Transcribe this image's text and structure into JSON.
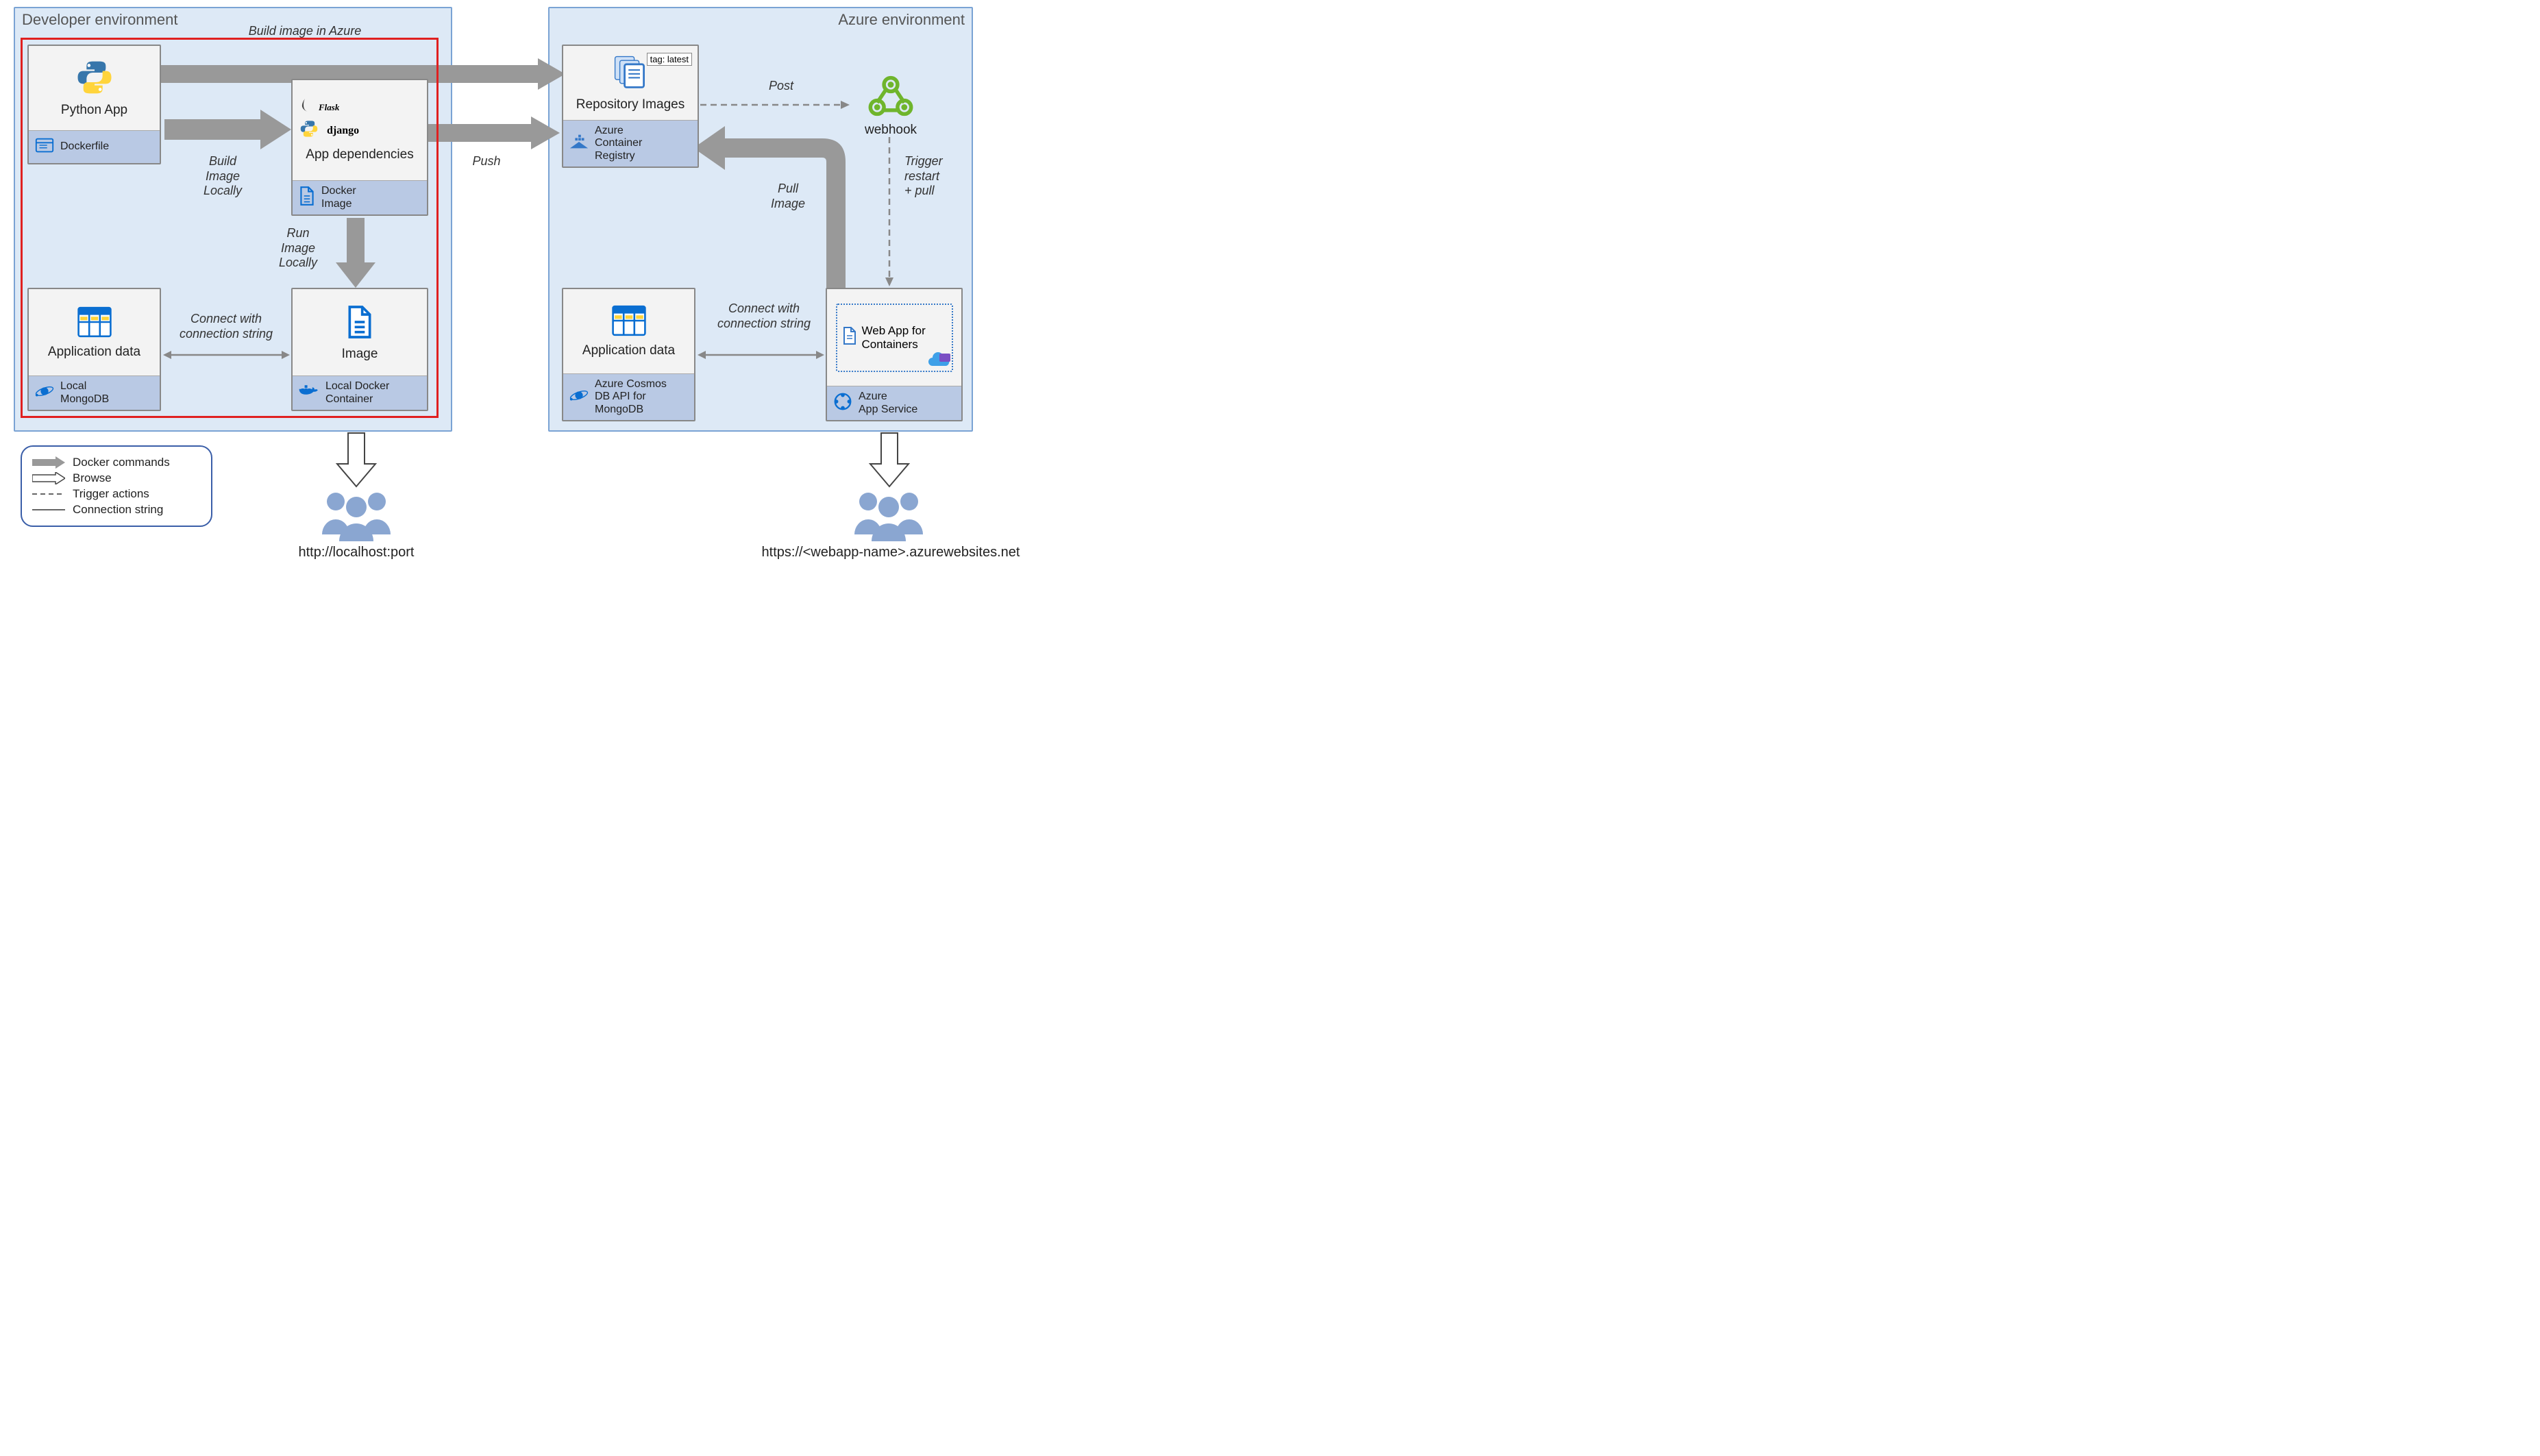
{
  "environments": {
    "dev": {
      "title": "Developer environment"
    },
    "azure": {
      "title": "Azure environment"
    }
  },
  "cards": {
    "pythonApp": {
      "title": "Python App",
      "footer": "Dockerfile"
    },
    "appDeps": {
      "title": "App dependencies",
      "footer": "Docker\nImage",
      "tech": {
        "flask": "Flask",
        "django": "django"
      }
    },
    "appDataLocal": {
      "title": "Application data",
      "footer": "Local\nMongoDB"
    },
    "image": {
      "title": "Image",
      "footer": "Local Docker\nContainer"
    },
    "repoImages": {
      "title": "Repository Images",
      "footer": "Azure\nContainer\nRegistry",
      "tag": "tag: latest"
    },
    "webhook": {
      "title": "webhook"
    },
    "appDataAzure": {
      "title": "Application data",
      "footer": "Azure Cosmos\nDB API for\nMongoDB"
    },
    "webApp": {
      "inner": "Web App for\nContainers",
      "footer": "Azure\nApp Service"
    }
  },
  "labels": {
    "buildAzure": "Build image in Azure",
    "buildLocal": "Build\nImage\nLocally",
    "runLocal": "Run\nImage\nLocally",
    "connectLocal": "Connect with\nconnection string",
    "push": "Push",
    "post": "Post",
    "triggerRestart": "Trigger\nrestart\n+ pull",
    "pullImage": "Pull\nImage",
    "connectAzure": "Connect with\nconnection string"
  },
  "legend": {
    "docker": "Docker commands",
    "browse": "Browse",
    "trigger": "Trigger actions",
    "conn": "Connection string"
  },
  "urls": {
    "local": "http://localhost:port",
    "azure": "https://<webapp-name>.azurewebsites.net"
  }
}
